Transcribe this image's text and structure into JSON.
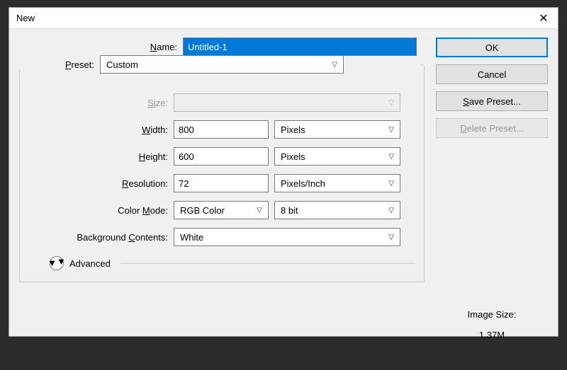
{
  "window": {
    "title": "New"
  },
  "labels": {
    "name": "ame:",
    "preset": "reset:",
    "size": "ze:",
    "width": "idth:",
    "height": "eight:",
    "resolution": "esolution:",
    "color_mode": "ode:",
    "bg_contents": "ontents:",
    "name_prefix": "N",
    "preset_prefix": "P",
    "size_prefix": "Si",
    "width_prefix": "W",
    "height_prefix": "H",
    "resolution_prefix": "R",
    "color_prefix_a": "Color ",
    "color_prefix_b": "M",
    "bg_prefix_a": "Background ",
    "bg_prefix_b": "C",
    "advanced": "Advanced"
  },
  "fields": {
    "name": "Untitled-1",
    "preset": "Custom",
    "size": "",
    "width": "800",
    "width_unit": "Pixels",
    "height": "600",
    "height_unit": "Pixels",
    "resolution": "72",
    "resolution_unit": "Pixels/Inch",
    "color_mode": "RGB Color",
    "color_depth": "8 bit",
    "bg_contents": "White"
  },
  "buttons": {
    "ok": "OK",
    "cancel": "Cancel",
    "save_preset_a": "S",
    "save_preset_b": "ave Preset...",
    "delete_preset_a": "D",
    "delete_preset_b": "elete Preset..."
  },
  "info": {
    "image_size_label": "Image Size:",
    "image_size_value": "1.37M"
  }
}
